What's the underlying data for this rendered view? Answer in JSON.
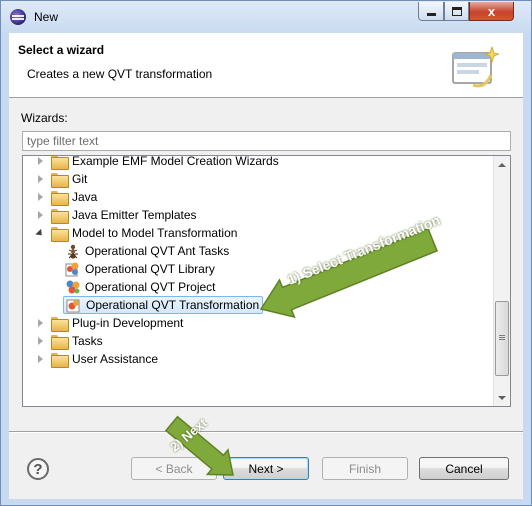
{
  "window": {
    "title": "New",
    "close_glyph": "x",
    "colors": {
      "frame": "#c7daf1",
      "close": "#c8432d"
    }
  },
  "header": {
    "title": "Select a wizard",
    "description": "Creates a new QVT transformation"
  },
  "wizards": {
    "label": "Wizards:",
    "filter_placeholder": "type filter text",
    "items": [
      {
        "label": "Example EMF Model Creation Wizards",
        "type": "folder",
        "expanded": false
      },
      {
        "label": "Git",
        "type": "folder",
        "expanded": false
      },
      {
        "label": "Java",
        "type": "folder",
        "expanded": false
      },
      {
        "label": "Java Emitter Templates",
        "type": "folder",
        "expanded": false
      },
      {
        "label": "Model to Model Transformation",
        "type": "folder",
        "expanded": true
      },
      {
        "label": "Operational QVT Ant Tasks",
        "type": "ant-task-icon"
      },
      {
        "label": "Operational QVT Library",
        "type": "qvt-library-icon"
      },
      {
        "label": "Operational QVT Project",
        "type": "qvt-project-icon"
      },
      {
        "label": "Operational QVT Transformation",
        "type": "qvt-transformation-icon",
        "selected": true
      },
      {
        "label": "Plug-in Development",
        "type": "folder",
        "expanded": false
      },
      {
        "label": "Tasks",
        "type": "folder",
        "expanded": false
      },
      {
        "label": "User Assistance",
        "type": "folder",
        "expanded": false
      }
    ]
  },
  "buttons": {
    "help": "?",
    "back": "< Back",
    "next": "Next >",
    "finish": "Finish",
    "cancel": "Cancel"
  },
  "annotations": {
    "step1": "1) Select Transformation",
    "step2": "2) Next",
    "color": "#80a93b"
  }
}
